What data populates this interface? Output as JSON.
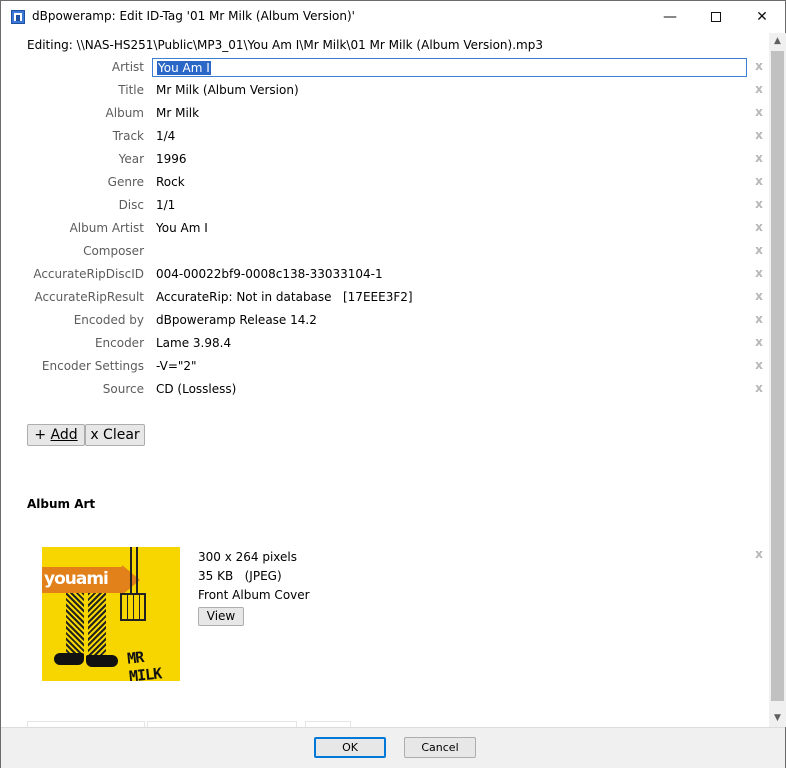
{
  "window": {
    "title": "dBpoweramp: Edit ID-Tag '01 Mr Milk (Album Version)'",
    "minimize_glyph": "—",
    "close_glyph": "✕"
  },
  "editing_path": "Editing: \\\\NAS-HS251\\Public\\MP3_01\\You Am I\\Mr Milk\\01 Mr Milk (Album Version).mp3",
  "delete_glyph": "x",
  "tags": [
    {
      "label": "Artist",
      "value": "You Am I"
    },
    {
      "label": "Title",
      "value": "Mr Milk (Album Version)"
    },
    {
      "label": "Album",
      "value": "Mr Milk"
    },
    {
      "label": "Track",
      "value": "1/4"
    },
    {
      "label": "Year",
      "value": "1996"
    },
    {
      "label": "Genre",
      "value": "Rock"
    },
    {
      "label": "Disc",
      "value": "1/1"
    },
    {
      "label": "Album Artist",
      "value": "You Am I"
    },
    {
      "label": "Composer",
      "value": ""
    },
    {
      "label": "AccurateRipDiscID",
      "value": "004-00022bf9-0008c138-33033104-1"
    },
    {
      "label": "AccurateRipResult",
      "value": "AccurateRip: Not in database   [17EEE3F2]"
    },
    {
      "label": "Encoded by",
      "value": "dBpoweramp Release 14.2"
    },
    {
      "label": "Encoder",
      "value": "Lame 3.98.4"
    },
    {
      "label": "Encoder Settings",
      "value": "-V=\"2\""
    },
    {
      "label": "Source",
      "value": "CD (Lossless)"
    }
  ],
  "buttons": {
    "add_prefix": "+ ",
    "add_label": "Add",
    "clear_label": "x Clear",
    "view_label": "View",
    "ok_label": "OK",
    "cancel_label": "Cancel"
  },
  "album_art": {
    "section_title": "Album Art",
    "dimensions": "300 x 264 pixels",
    "size": "35 KB   (JPEG)",
    "type": "Front Album Cover",
    "cover_text_top": "youami",
    "cover_text_bottom": "MR MILK"
  },
  "colors": {
    "selection": "#2b67c7",
    "focus_border": "#3c7fd1",
    "cover_yellow": "#f7d600",
    "cover_orange": "#e2801a"
  }
}
